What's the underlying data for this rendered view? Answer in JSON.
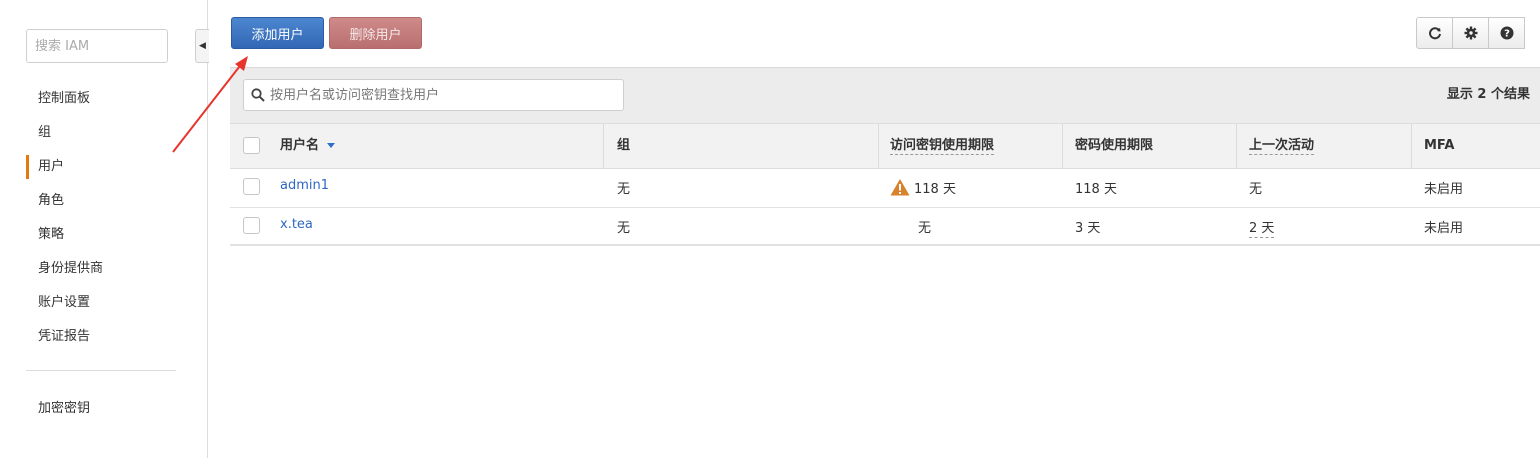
{
  "sidebar": {
    "search_placeholder": "搜索 IAM",
    "items": [
      {
        "label": "控制面板"
      },
      {
        "label": "组"
      },
      {
        "label": "用户",
        "active": true
      },
      {
        "label": "角色"
      },
      {
        "label": "策略"
      },
      {
        "label": "身份提供商"
      },
      {
        "label": "账户设置"
      },
      {
        "label": "凭证报告"
      }
    ],
    "secondary_items": [
      {
        "label": "加密密钥"
      }
    ]
  },
  "toolbar": {
    "add_user_label": "添加用户",
    "delete_user_label": "删除用户",
    "icons": [
      "refresh-icon",
      "gear-icon",
      "help-icon"
    ]
  },
  "grid": {
    "search_placeholder": "按用户名或访问密钥查找用户",
    "results_label": "显示 2 个结果",
    "columns": {
      "username": "用户名",
      "group": "组",
      "access_key_age": "访问密钥使用期限",
      "password_age": "密码使用期限",
      "last_activity": "上一次活动",
      "mfa": "MFA"
    },
    "rows": [
      {
        "username": "admin1",
        "group": "无",
        "access_key_age": "118 天",
        "access_key_warning": true,
        "password_age": "118 天",
        "last_activity": "无",
        "mfa": "未启用"
      },
      {
        "username": "x.tea",
        "group": "无",
        "access_key_age": "无",
        "access_key_warning": false,
        "password_age": "3 天",
        "last_activity": "2 天",
        "mfa": "未启用"
      }
    ]
  },
  "colors": {
    "primary_button": "#3b73c0",
    "danger_button": "#c07b7b",
    "link": "#2f68c3",
    "active_indicator": "#e47911",
    "warning": "#d9822b",
    "annotation_arrow": "#e8352b"
  }
}
